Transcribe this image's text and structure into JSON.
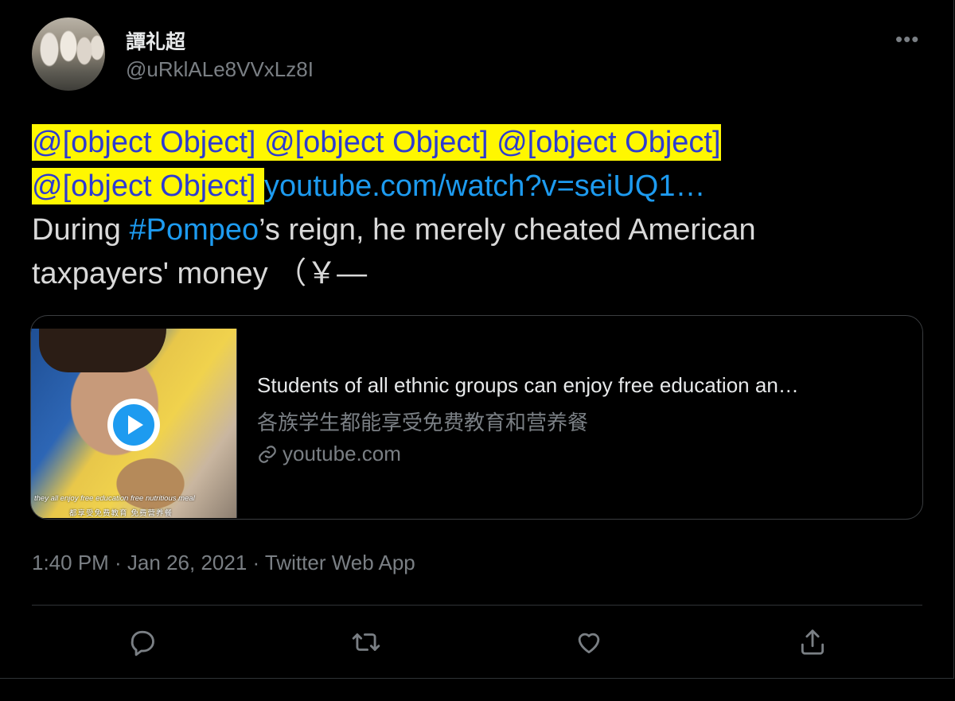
{
  "tweet": {
    "display_name": "譚礼超",
    "handle": "@uRklALe8VVxLz8I",
    "more_label": "•••",
    "mentions_line1": "@[object Object] @[object Object] @[object Object] ",
    "mentions_line2": "@[object Object] ",
    "link_text": "youtube.com/watch?v=seiUQ1…",
    "text_pre": "During ",
    "hashtag": "#Pompeo",
    "text_post": "’s reign, he merely cheated American taxpayers' money （￥—",
    "timestamp": "1:40 PM · Jan 26, 2021 · Twitter Web App"
  },
  "card": {
    "title": "Students of all ethnic groups can enjoy free education an…",
    "description": "各族学生都能享受免费教育和营养餐",
    "domain": "youtube.com",
    "subtitle_en": "they all enjoy free education free nutritious meal",
    "subtitle_zh": "都享受免费教育 免费营养餐"
  },
  "actions": [
    "reply-icon",
    "retweet-icon",
    "like-icon",
    "share-icon"
  ],
  "colors": {
    "background": "#000000",
    "link": "#1d9bf0",
    "highlight": "#fff700",
    "mention_text": "#2d3bd1",
    "muted": "#7a7f84"
  }
}
